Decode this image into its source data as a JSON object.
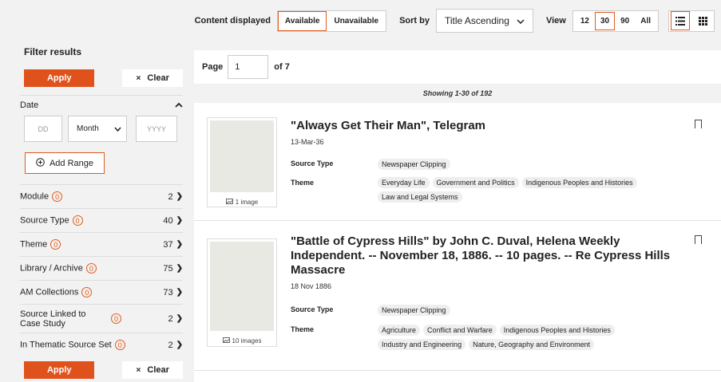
{
  "toolbar": {
    "content_label": "Content displayed",
    "available": "Available",
    "unavailable": "Unavailable",
    "sort_label": "Sort by",
    "sort_value": "Title Ascending",
    "view_label": "View",
    "view_options": [
      "12",
      "30",
      "90",
      "All"
    ],
    "accent": "#e05a1c"
  },
  "sidebar": {
    "title": "Filter results",
    "apply": "Apply",
    "clear": "Clear",
    "date_label": "Date",
    "dd_placeholder": "DD",
    "month": "Month",
    "yyyy_placeholder": "YYYY",
    "add_range": "Add Range",
    "facets": [
      {
        "label": "Module",
        "badge": "0",
        "count": "2"
      },
      {
        "label": "Source Type",
        "badge": "0",
        "count": "40"
      },
      {
        "label": "Theme",
        "badge": "0",
        "count": "37"
      },
      {
        "label": "Library / Archive",
        "badge": "0",
        "count": "75"
      },
      {
        "label": "AM Collections",
        "badge": "0",
        "count": "73"
      },
      {
        "label": "Source Linked to Case Study",
        "badge": "0",
        "count": "2"
      },
      {
        "label": "In Thematic Source Set",
        "badge": "0",
        "count": "2"
      }
    ]
  },
  "pager": {
    "label": "Page",
    "value": "1",
    "of": "of 7"
  },
  "showing": "Showing 1-30 of 192",
  "results": [
    {
      "title": "\"Always Get Their Man\", Telegram",
      "date": "13-Mar-36",
      "images": "1 image",
      "source_type_label": "Source Type",
      "source_type": "Newspaper Clipping",
      "theme_label": "Theme",
      "themes": [
        "Everyday Life",
        "Government and Politics",
        "Indigenous Peoples and Histories",
        "Law and Legal Systems"
      ]
    },
    {
      "title_line1": "\"Battle of Cypress Hills\" by John C. Duval, Helena Weekly",
      "title_line2": "Independent. -- November 18, 1886. -- 10 pages. -- Re Cypress Hills",
      "title_line3": "Massacre",
      "date": "18 Nov 1886",
      "images": "10 images",
      "source_type_label": "Source Type",
      "source_type": "Newspaper Clipping",
      "theme_label": "Theme",
      "themes": [
        "Agriculture",
        "Conflict and Warfare",
        "Indigenous Peoples and Histories",
        "Industry and Engineering",
        "Nature, Geography and Environment"
      ]
    }
  ]
}
